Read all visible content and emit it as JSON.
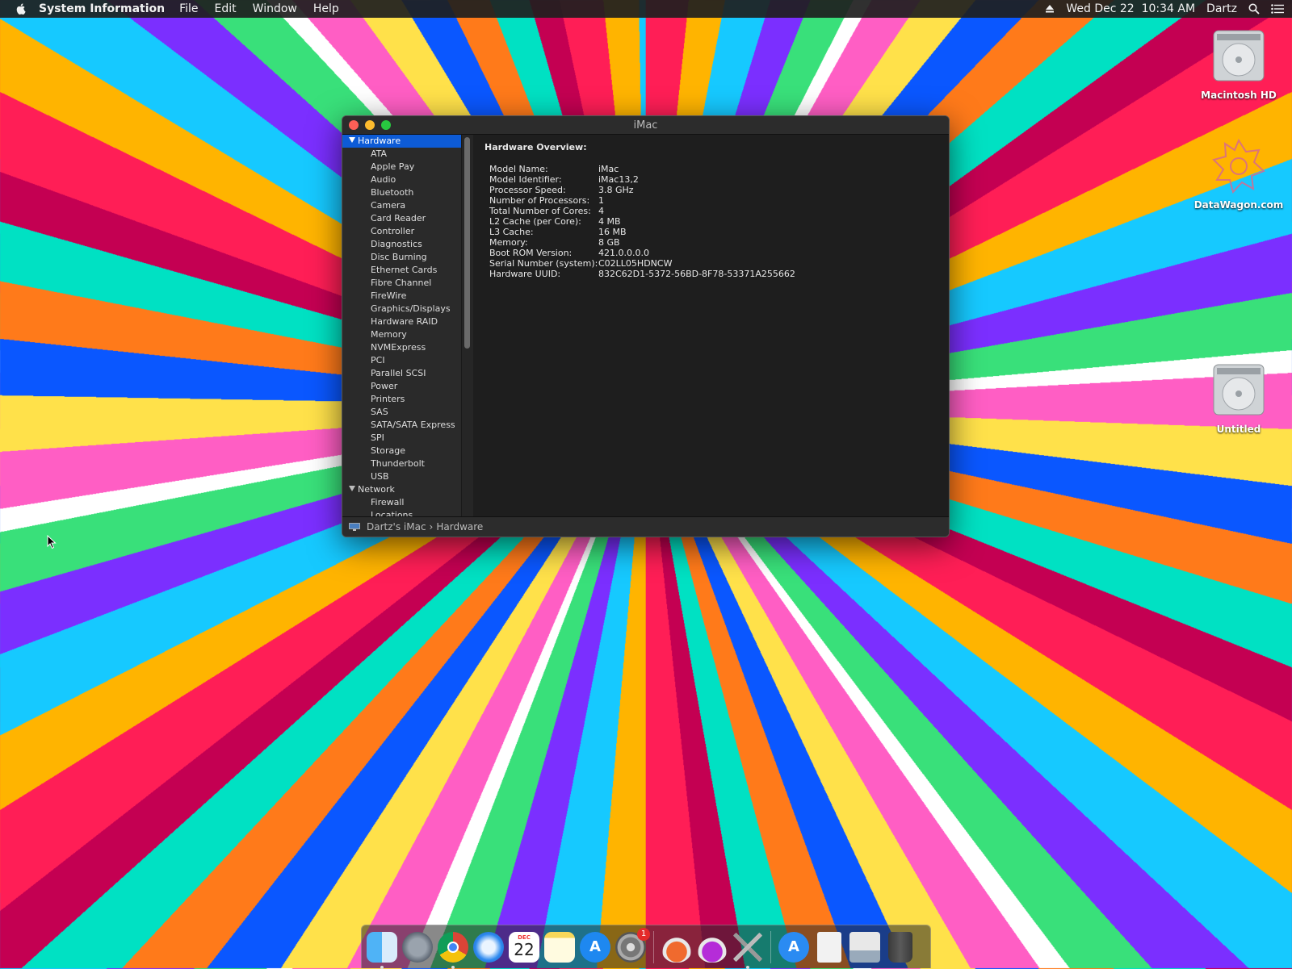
{
  "menubar": {
    "app_name": "System Information",
    "menus": [
      "File",
      "Edit",
      "Window",
      "Help"
    ],
    "datetime": "Wed Dec 22  10:34 AM",
    "user": "Dartz"
  },
  "desktop_icons": [
    {
      "label": "Macintosh HD",
      "icon": "hard-drive-icon"
    },
    {
      "label": "DataWagon.com",
      "icon": "folder-pattern-icon"
    },
    {
      "label": "Untitled",
      "icon": "hard-drive-icon"
    }
  ],
  "window": {
    "title": "iMac",
    "sidebar": {
      "groups": [
        {
          "label": "Hardware",
          "selected": true,
          "items": [
            "ATA",
            "Apple Pay",
            "Audio",
            "Bluetooth",
            "Camera",
            "Card Reader",
            "Controller",
            "Diagnostics",
            "Disc Burning",
            "Ethernet Cards",
            "Fibre Channel",
            "FireWire",
            "Graphics/Displays",
            "Hardware RAID",
            "Memory",
            "NVMExpress",
            "PCI",
            "Parallel SCSI",
            "Power",
            "Printers",
            "SAS",
            "SATA/SATA Express",
            "SPI",
            "Storage",
            "Thunderbolt",
            "USB"
          ]
        },
        {
          "label": "Network",
          "selected": false,
          "items": [
            "Firewall",
            "Locations"
          ]
        }
      ]
    },
    "content": {
      "heading": "Hardware Overview:",
      "rows": [
        {
          "key": "Model Name:",
          "value": "iMac"
        },
        {
          "key": "Model Identifier:",
          "value": "iMac13,2"
        },
        {
          "key": "Processor Speed:",
          "value": "3.8 GHz"
        },
        {
          "key": "Number of Processors:",
          "value": "1"
        },
        {
          "key": "Total Number of Cores:",
          "value": "4"
        },
        {
          "key": "L2 Cache (per Core):",
          "value": "4 MB"
        },
        {
          "key": "L3 Cache:",
          "value": "16 MB"
        },
        {
          "key": "Memory:",
          "value": "8 GB"
        },
        {
          "key": "Boot ROM Version:",
          "value": "421.0.0.0.0"
        },
        {
          "key": "Serial Number (system):",
          "value": "C02LL05HDNCW"
        },
        {
          "key": "Hardware UUID:",
          "value": "832C62D1-5372-56BD-8F78-53371A255662"
        }
      ]
    },
    "breadcrumb": {
      "computer": "Dartz's iMac",
      "separator": "›",
      "section": "Hardware"
    }
  },
  "dock": {
    "calendar_month": "DEC",
    "calendar_day": "22",
    "system_preferences_badge": "1",
    "apps": [
      "finder-icon",
      "launchpad-icon",
      "chrome-icon",
      "safari-icon",
      "calendar-icon",
      "notes-icon",
      "app-store-icon",
      "system-preferences-icon",
      "potion-icon",
      "potion-purple-icon",
      "tool-icon",
      "app-store-alt-icon",
      "document-icon",
      "preview-icon",
      "trash-icon"
    ]
  },
  "colors": {
    "selection": "#0d5bd6",
    "window_bg": "#1e1e1e"
  }
}
